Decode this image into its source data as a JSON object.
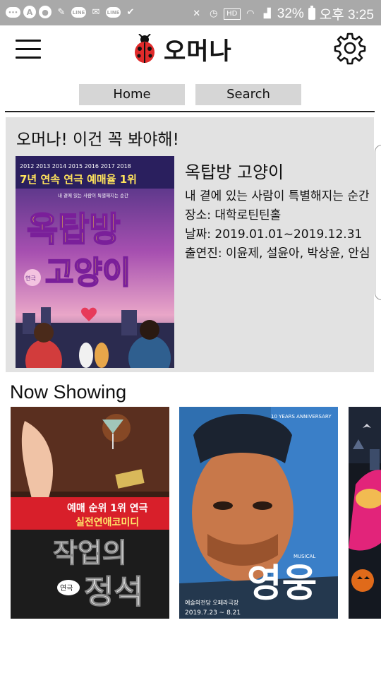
{
  "status_bar": {
    "battery": "32%",
    "time": "오후 3:25",
    "icons": [
      "chat-icon",
      "a-icon",
      "bubble-icon",
      "brush-icon",
      "line-icon",
      "mail-icon",
      "line-icon",
      "check-icon",
      "mute-icon",
      "alarm-icon",
      "hd-icon",
      "wifi-icon",
      "signal-icon",
      "battery-icon"
    ]
  },
  "header": {
    "app_title": "오머나",
    "menu_icon": "hamburger-icon",
    "logo_icon": "ladybug-icon",
    "settings_icon": "gear-icon"
  },
  "nav": {
    "tabs": [
      {
        "label": "Home"
      },
      {
        "label": "Search"
      }
    ]
  },
  "featured": {
    "heading": "오머나! 이건 꼭 봐야해!",
    "show": {
      "title": "옥탑방 고양이",
      "description": "내 곁에 있는 사람이 특별해지는 순간",
      "venue": "장소: 대학로틴틴홀",
      "dates": "날짜: 2019.01.01~2019.12.31",
      "cast": "출연진: 이윤제, 설윤아, 박상윤, 안심"
    },
    "poster": {
      "years": "2012 2013 2014 2015 2016 2017 2018",
      "banner": "7년 연속 연극 예매율 1위",
      "tagline": "내 곁에 있는 사람이 특별해지는 순간",
      "title_line1": "옥탑방",
      "title_line2": "고양이",
      "badge": "연극"
    }
  },
  "now_showing": {
    "title": "Now Showing",
    "posters": [
      {
        "band_text_1": "예매 순위 1위 연극",
        "band_text_2": "실전연애코미디",
        "title_line1": "작업의",
        "title_line2": "정석",
        "badge": "연극"
      },
      {
        "anniversary": "10 YEARS ANNIVERSARY",
        "genre": "MUSICAL",
        "title": "영웅",
        "venue": "예술의전당 오페라극장",
        "dates": "2019.7.23 ~ 8.21"
      },
      {
        "title": "",
        "partial": true
      }
    ]
  }
}
